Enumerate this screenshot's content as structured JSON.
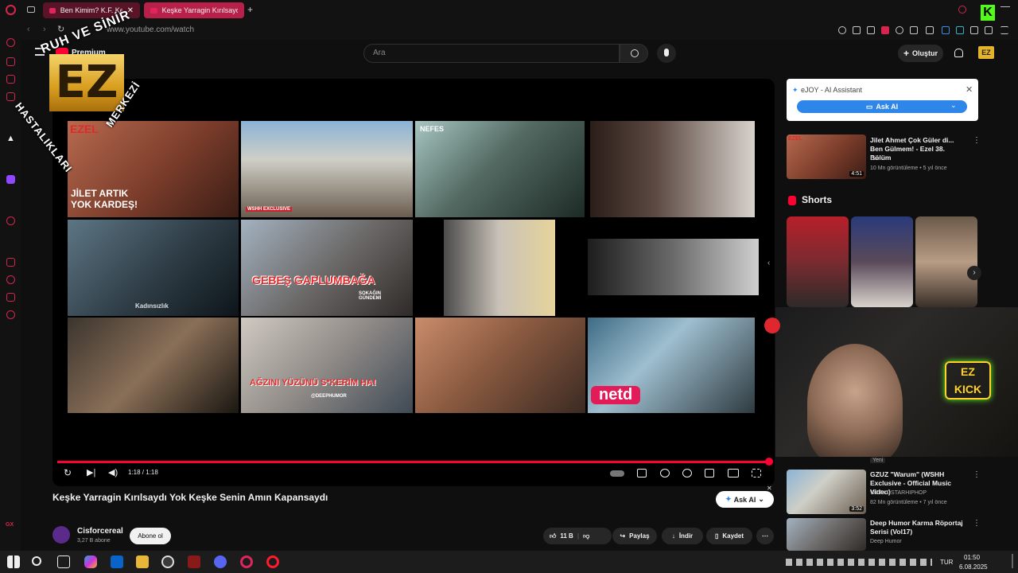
{
  "browser": {
    "tabs": [
      {
        "label": "Ben Kimim? K.F. Kene"
      },
      {
        "label": "Keşke Yarragin Kırılsaydı"
      }
    ],
    "address": "www.youtube.com/watch",
    "accent_color": "#d8244f"
  },
  "youtube": {
    "premium_label": "Premium",
    "search_placeholder": "Ara",
    "create_label": "Oluştur",
    "avatar_text": "EZ"
  },
  "player": {
    "time": "1:18 / 1:18",
    "progress": 1.0,
    "thumbnails": [
      {
        "caption": "JİLET ARTIK YOK KARDEŞ!",
        "tag": "EZEL"
      },
      {
        "caption": "WSHH EXCLUSIVE",
        "tag": ""
      },
      {
        "caption": "",
        "tag": "NEFES"
      },
      {
        "caption": "",
        "tag": ""
      },
      {
        "caption": "Kadınsızlık",
        "tag": ""
      },
      {
        "caption": "GEBEŞ GAPLUMBAĞA",
        "tag": "SOKAĞIN GÜNDEMİ"
      },
      {
        "caption": "",
        "tag": ""
      },
      {
        "caption": "",
        "tag": ""
      },
      {
        "caption": "",
        "tag": ""
      },
      {
        "caption": "AĞZINI YÜZÜNÜ S*KERİM HA!",
        "tag": "@DEEPHUMOR"
      },
      {
        "caption": "",
        "tag": ""
      },
      {
        "caption": "netd",
        "tag": ""
      }
    ]
  },
  "video": {
    "title": "Keşke Yarragin Kırılsaydı Yok Keşke Senin Amın Kapansaydı",
    "ask_ai_label": "Ask AI",
    "channel_name": "Cisforcereal",
    "channel_subs": "3,27 B abone",
    "subscribe_label": "Abone ol",
    "like_count": "11 B",
    "share_label": "Paylaş",
    "download_label": "İndir",
    "save_label": "Kaydet"
  },
  "ejoy": {
    "title": "eJOY - AI Assistant",
    "button_label": "Ask AI"
  },
  "recommendations": [
    {
      "title": "Jilet Ahmet Çok Güler di... Ben Gülmem! - Ezel 38. Bölüm",
      "channel": "Ezel",
      "meta": "10 Mn görüntüleme • 5 yıl önce",
      "duration": "4:51"
    },
    {
      "title": "GZUZ \"Warum\" (WSHH Exclusive - Official Music Video)",
      "channel": "WORLDSTARHIPHOP",
      "meta": "82 Mn görüntüleme • 7 yıl önce",
      "duration": "3:52",
      "badge": "Yeni"
    },
    {
      "title": "Deep Humor Karma Röportaj Serisi (Vol17)",
      "channel": "Deep Humor",
      "meta": "",
      "duration": ""
    }
  ],
  "shorts_label": "Shorts",
  "watermark": {
    "top": "RUH VE SİNİR",
    "left": "HASTALIKLARI",
    "right": "MERKEZİ",
    "logo": "EZ"
  },
  "webcam": {
    "sign": "EZ KICK"
  },
  "taskbar": {
    "lang": "TUR",
    "time": "01:50",
    "date": "6.08.2025"
  }
}
